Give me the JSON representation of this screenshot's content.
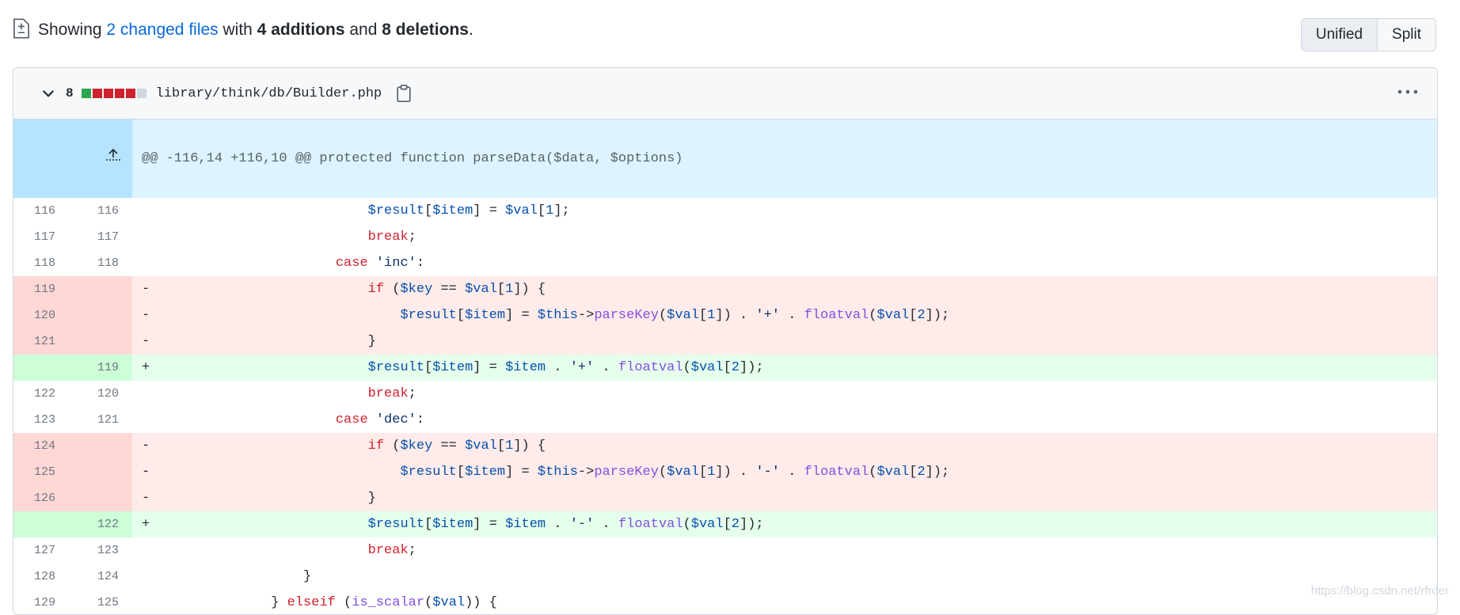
{
  "summary": {
    "prefix": "Showing ",
    "changed_files": "2 changed files",
    "with": " with ",
    "additions": "4 additions",
    "and": " and ",
    "deletions": "8 deletions",
    "suffix": "."
  },
  "view_toggle": {
    "unified": "Unified",
    "split": "Split"
  },
  "file": {
    "change_count": "8",
    "diffstat": [
      "add",
      "del",
      "del",
      "del",
      "del",
      "neutral"
    ],
    "path": "library/think/db/Builder.php"
  },
  "hunk_header": "@@ -116,14 +116,10 @@ protected function parseData($data, $options)",
  "lines": [
    {
      "type": "ctx",
      "old": "116",
      "new": "116",
      "marker": " ",
      "code": "                        $result[$item] = $val[1];"
    },
    {
      "type": "ctx",
      "old": "117",
      "new": "117",
      "marker": " ",
      "code": "                        break;"
    },
    {
      "type": "ctx",
      "old": "118",
      "new": "118",
      "marker": " ",
      "code": "                    case 'inc':"
    },
    {
      "type": "del",
      "old": "119",
      "new": "",
      "marker": "-",
      "code": "                        if ($key == $val[1]) {"
    },
    {
      "type": "del",
      "old": "120",
      "new": "",
      "marker": "-",
      "code": "                            $result[$item] = $this->parseKey($val[1]) . '+' . floatval($val[2]);"
    },
    {
      "type": "del",
      "old": "121",
      "new": "",
      "marker": "-",
      "code": "                        }"
    },
    {
      "type": "add",
      "old": "",
      "new": "119",
      "marker": "+",
      "code": "                        $result[$item] = $item . '+' . floatval($val[2]);"
    },
    {
      "type": "ctx",
      "old": "122",
      "new": "120",
      "marker": " ",
      "code": "                        break;"
    },
    {
      "type": "ctx",
      "old": "123",
      "new": "121",
      "marker": " ",
      "code": "                    case 'dec':"
    },
    {
      "type": "del",
      "old": "124",
      "new": "",
      "marker": "-",
      "code": "                        if ($key == $val[1]) {"
    },
    {
      "type": "del",
      "old": "125",
      "new": "",
      "marker": "-",
      "code": "                            $result[$item] = $this->parseKey($val[1]) . '-' . floatval($val[2]);"
    },
    {
      "type": "del",
      "old": "126",
      "new": "",
      "marker": "-",
      "code": "                        }"
    },
    {
      "type": "add",
      "old": "",
      "new": "122",
      "marker": "+",
      "code": "                        $result[$item] = $item . '-' . floatval($val[2]);"
    },
    {
      "type": "ctx",
      "old": "127",
      "new": "123",
      "marker": " ",
      "code": "                        break;"
    },
    {
      "type": "ctx",
      "old": "128",
      "new": "124",
      "marker": " ",
      "code": "                }"
    },
    {
      "type": "ctx",
      "old": "129",
      "new": "125",
      "marker": " ",
      "code": "            } elseif (is_scalar($val)) {"
    }
  ],
  "watermark": "https://blog.csdn.net/rfrder",
  "colors": {
    "accent": "#0969da",
    "added": "#e6ffec",
    "deleted": "#ffebe9",
    "hunk": "#ddf4ff"
  }
}
